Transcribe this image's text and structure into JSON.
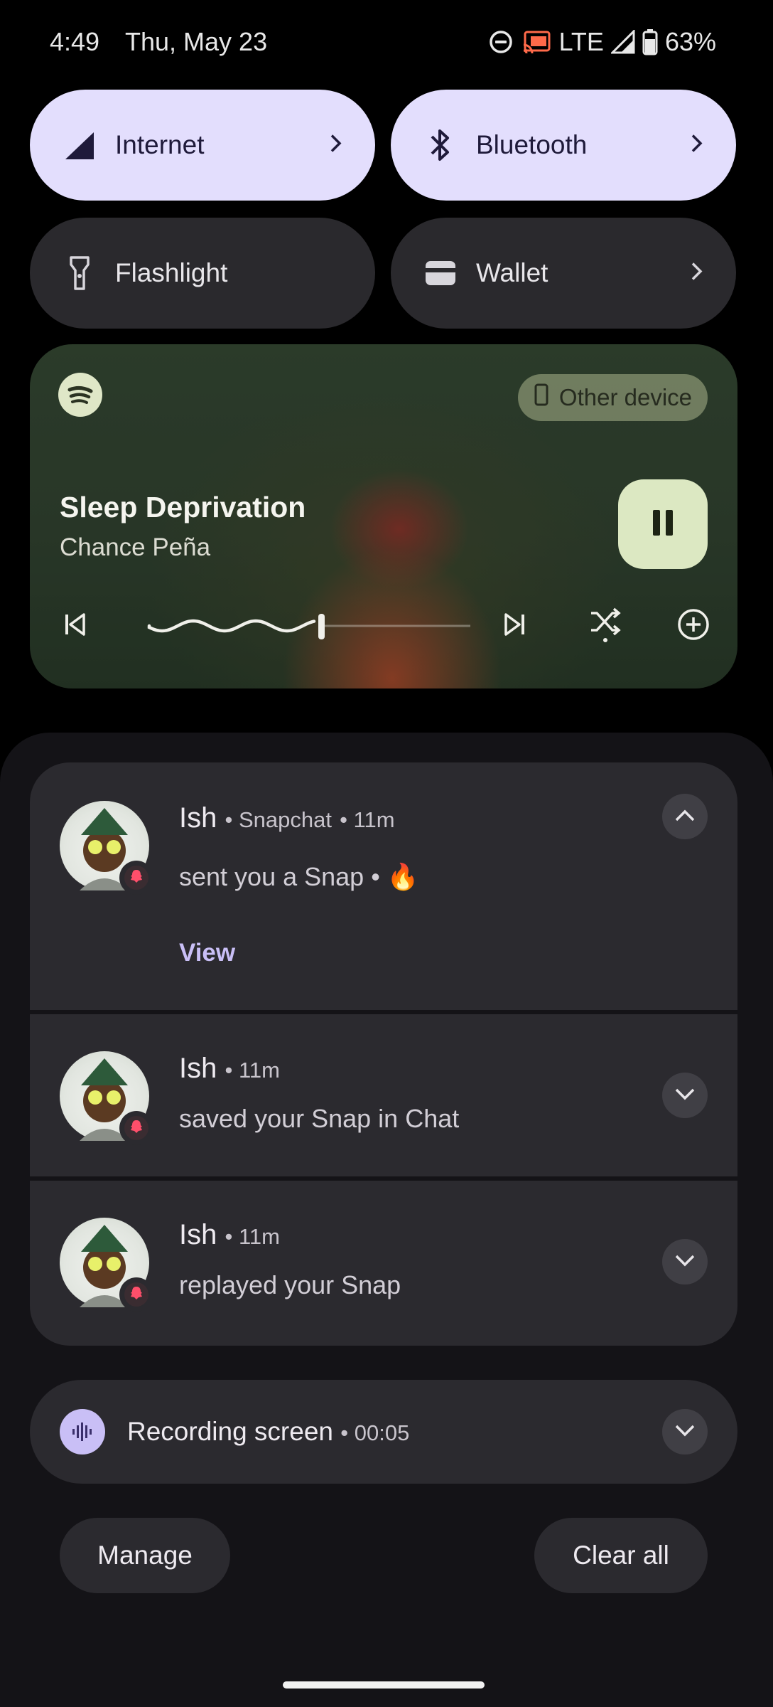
{
  "status_bar": {
    "time": "4:49",
    "date": "Thu, May 23",
    "network": "LTE",
    "battery": "63%",
    "icons": [
      "do-not-disturb-icon",
      "cast-icon",
      "signal-icon",
      "battery-icon"
    ]
  },
  "quick_tiles": [
    {
      "label": "Internet",
      "icon": "signal-icon",
      "active": true,
      "chevron": true
    },
    {
      "label": "Bluetooth",
      "icon": "bluetooth-icon",
      "active": true,
      "chevron": true
    },
    {
      "label": "Flashlight",
      "icon": "flashlight-icon",
      "active": false,
      "chevron": false
    },
    {
      "label": "Wallet",
      "icon": "wallet-icon",
      "active": false,
      "chevron": true
    }
  ],
  "media": {
    "app_icon": "spotify-icon",
    "output_device": "Other device",
    "title": "Sleep Deprivation",
    "artist": "Chance Peña",
    "progress": 0.54,
    "state": "playing",
    "controls": [
      "previous-icon",
      "pause-icon",
      "next-icon",
      "shuffle-icon",
      "add-icon"
    ]
  },
  "notifications": [
    {
      "sender": "Ish",
      "app": "Snapchat",
      "time": "11m",
      "text": "sent you a Snap • 🔥",
      "action": "View",
      "expanded": true
    },
    {
      "sender": "Ish",
      "time": "11m",
      "text": "saved your Snap in Chat",
      "expanded": false
    },
    {
      "sender": "Ish",
      "time": "11m",
      "text": "replayed your Snap",
      "expanded": false
    }
  ],
  "recording": {
    "label": "Recording screen",
    "elapsed": "00:05"
  },
  "footer": {
    "manage": "Manage",
    "clear_all": "Clear all"
  },
  "colors": {
    "tile_active": "#e3defd",
    "tile_inactive": "#2a292d",
    "accent_link": "#c9bff6",
    "snap_badge": "#ff4f6b"
  }
}
